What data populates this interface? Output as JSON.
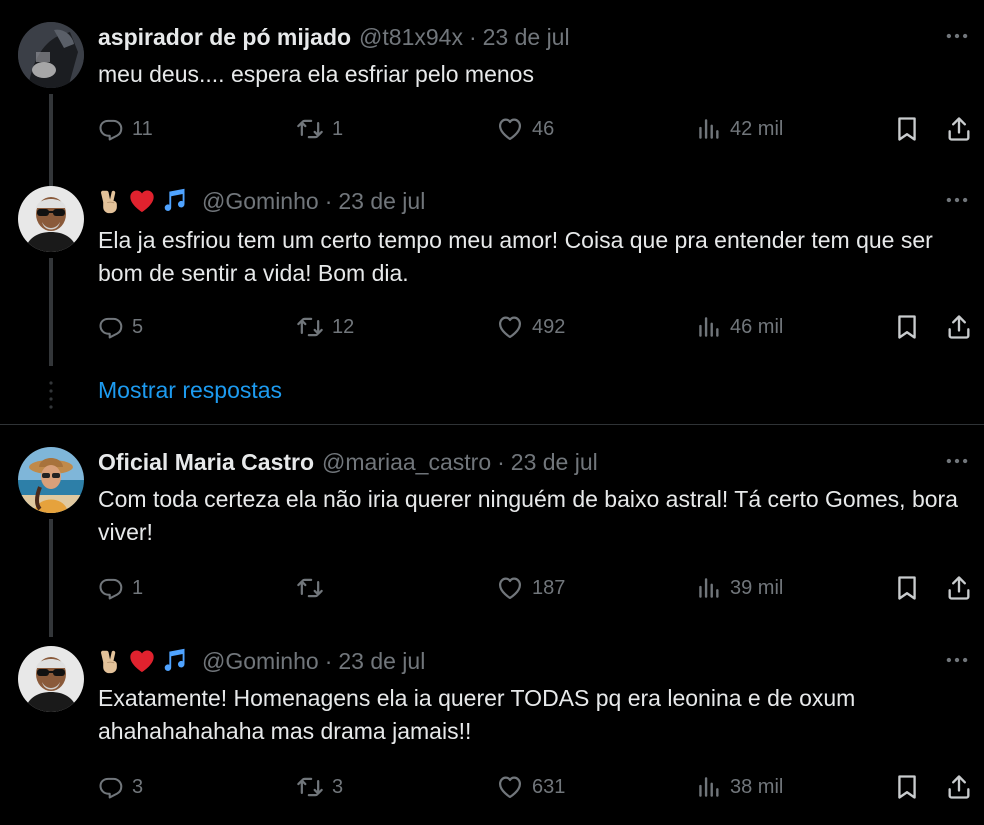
{
  "colors": {
    "background": "#000000",
    "text_primary": "#e7e9ea",
    "text_secondary": "#71767b",
    "link": "#1d9bf0",
    "divider": "#2f3336"
  },
  "tweets": [
    {
      "name": "aspirador de pó mijado",
      "handle": "@t81x94x",
      "separator": "·",
      "date": "23 de jul",
      "text": "meu deus.... espera ela esfriar pelo menos",
      "replies": "11",
      "retweets": "1",
      "likes": "46",
      "views": "42 mil"
    },
    {
      "name_emojis": [
        "victory-hand-icon",
        "red-heart-icon",
        "musical-notes-icon"
      ],
      "handle": "@Gominho",
      "separator": "·",
      "date": "23 de jul",
      "text": "Ela ja esfriou tem um certo tempo meu amor! Coisa que pra entender tem que ser bom de sentir a vida! Bom dia.",
      "replies": "5",
      "retweets": "12",
      "likes": "492",
      "views": "46 mil"
    },
    {
      "name": "Oficial Maria Castro",
      "handle": "@mariaa_castro",
      "separator": "·",
      "date": "23 de jul",
      "text": "Com toda certeza ela não iria querer ninguém de baixo astral! Tá certo Gomes, bora viver!",
      "replies": "1",
      "retweets": "",
      "likes": "187",
      "views": "39 mil"
    },
    {
      "name_emojis": [
        "victory-hand-icon",
        "red-heart-icon",
        "musical-notes-icon"
      ],
      "handle": "@Gominho",
      "separator": "·",
      "date": "23 de jul",
      "text": "Exatamente! Homenagens ela ia querer TODAS pq era leonina e de oxum ahahahahahaha mas drama jamais!!",
      "replies": "3",
      "retweets": "3",
      "likes": "631",
      "views": "38 mil"
    }
  ],
  "show_replies_label": "Mostrar respostas"
}
